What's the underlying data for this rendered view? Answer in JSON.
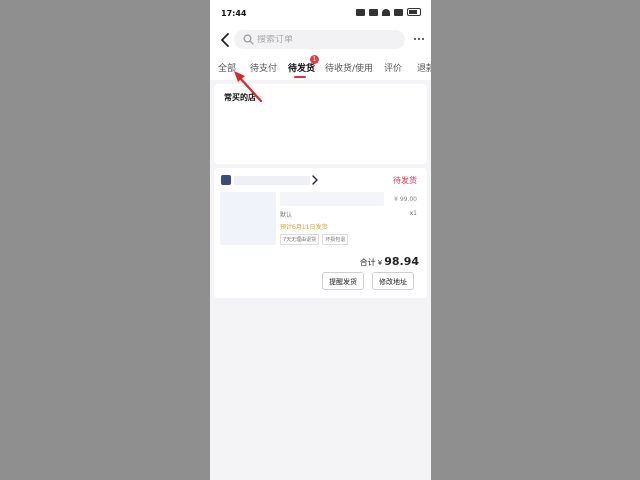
{
  "status_bar": {
    "time": "17:44"
  },
  "search": {
    "placeholder": "搜索订单"
  },
  "tabs": [
    {
      "label": "全部"
    },
    {
      "label": "待支付"
    },
    {
      "label": "待发货",
      "badge": "1"
    },
    {
      "label": "待收货/使用"
    },
    {
      "label": "评价"
    },
    {
      "label": "退款"
    }
  ],
  "stores": {
    "title": "常买的店"
  },
  "order": {
    "status": "待发货",
    "price": "¥ 99.00",
    "spec": "默认",
    "qty": "x1",
    "ship_date": "预计6月11日发货",
    "tags": [
      "7天无理由退货",
      "坏损包退"
    ],
    "total_label": "合计",
    "currency": "¥",
    "total_amount": "98.94",
    "buttons": {
      "remind": "提醒发货",
      "change_address": "修改地址"
    }
  },
  "colors": {
    "accent": "#e02e3b",
    "ship_date": "#e59a2a",
    "arrow": "#d6272e"
  }
}
